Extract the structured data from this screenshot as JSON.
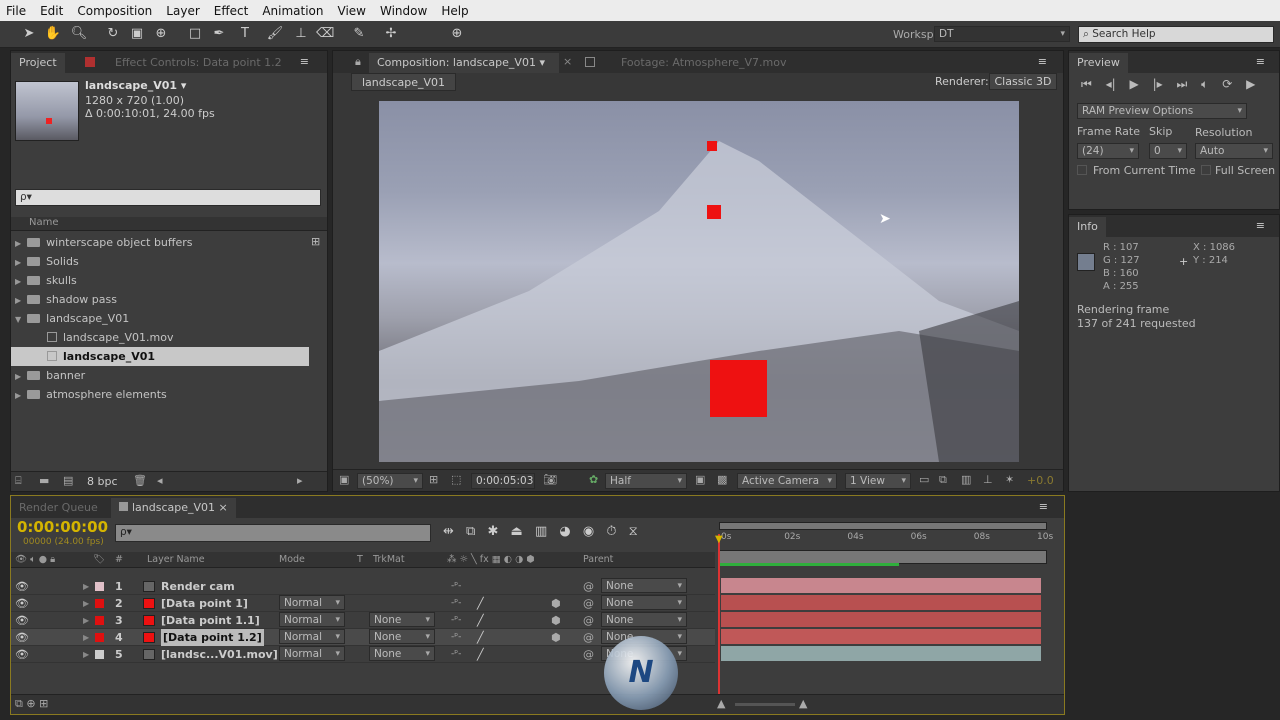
{
  "menu": [
    "File",
    "Edit",
    "Composition",
    "Layer",
    "Effect",
    "Animation",
    "View",
    "Window",
    "Help"
  ],
  "toolbar": {
    "workspace_label": "Workspace:",
    "workspace_value": "DT",
    "search_placeholder": "Search Help"
  },
  "project": {
    "tab": "Project",
    "effect_tab": "Effect Controls: Data point 1.2",
    "comp_name": "landscape_V01 ▾",
    "dims": "1280 x 720 (1.00)",
    "duration": "Δ 0:00:10:01, 24.00 fps",
    "search_placeholder": "ρ▾",
    "column_name": "Name",
    "bpc": "8 bpc",
    "items": [
      {
        "label": "winterscape object buffers",
        "type": "folder",
        "indent": 0
      },
      {
        "label": "Solids",
        "type": "folder",
        "indent": 0
      },
      {
        "label": "skulls",
        "type": "folder",
        "indent": 0
      },
      {
        "label": "shadow pass",
        "type": "folder",
        "indent": 0
      },
      {
        "label": "landscape_V01",
        "type": "folder",
        "indent": 0,
        "open": true
      },
      {
        "label": "landscape_V01.mov",
        "type": "footage",
        "indent": 1
      },
      {
        "label": "landscape_V01",
        "type": "comp",
        "indent": 1,
        "selected": true
      },
      {
        "label": "banner",
        "type": "folder",
        "indent": 0
      },
      {
        "label": "atmosphere elements",
        "type": "folder",
        "indent": 0
      }
    ]
  },
  "composition": {
    "tab": "Composition: landscape_V01",
    "footage_tab": "Footage: Atmosphere_V7.mov",
    "breadcrumb": "landscape_V01",
    "renderer_label": "Renderer:",
    "renderer_value": "Classic 3D",
    "zoom": "(50%)",
    "timecode": "0:00:05:03",
    "resolution": "Half",
    "camera": "Active Camera",
    "views": "1 View",
    "exposure": "+0.0"
  },
  "preview": {
    "tab": "Preview",
    "ram_options": "RAM Preview Options",
    "frame_rate_label": "Frame Rate",
    "skip_label": "Skip",
    "resolution_label": "Resolution",
    "frame_rate": "(24)",
    "skip": "0",
    "resolution": "Auto",
    "from_current": "From Current Time",
    "full_screen": "Full Screen"
  },
  "info": {
    "tab": "Info",
    "r": "R : 107",
    "g": "G : 127",
    "b": "B : 160",
    "a": "A : 255",
    "x": "X : 1086",
    "y": "Y : 214",
    "status_line1": "Rendering frame",
    "status_line2": "137 of 241 requested"
  },
  "timeline": {
    "render_queue_tab": "Render Queue",
    "comp_tab": "landscape_V01",
    "timecode": "0:00:00:00",
    "frames": "00000 (24.00 fps)",
    "search_placeholder": "ρ▾",
    "headers": {
      "num": "#",
      "layer_name": "Layer Name",
      "mode": "Mode",
      "t": "T",
      "trkmat": "TrkMat",
      "parent": "Parent"
    },
    "ruler": [
      "0s",
      "02s",
      "04s",
      "06s",
      "08s",
      "10s"
    ],
    "work_area_rendered_pct": 55,
    "layers": [
      {
        "num": "1",
        "name": "Render cam",
        "mode": "",
        "trkmat": "",
        "parent": "None",
        "color": "#e0c0c8",
        "bar": "#c8868e"
      },
      {
        "num": "2",
        "name": "[Data point 1]",
        "mode": "Normal",
        "trkmat": "",
        "parent": "None",
        "color": "#e01010",
        "bar": "#b85050"
      },
      {
        "num": "3",
        "name": "[Data point 1.1]",
        "mode": "Normal",
        "trkmat": "None",
        "parent": "None",
        "color": "#e01010",
        "bar": "#b85050"
      },
      {
        "num": "4",
        "name": "[Data point 1.2]",
        "mode": "Normal",
        "trkmat": "None",
        "parent": "None",
        "color": "#e01010",
        "bar": "#c05858",
        "selected": true
      },
      {
        "num": "5",
        "name": "[landsc...V01.mov]",
        "mode": "Normal",
        "trkmat": "None",
        "parent": "None",
        "color": "#cccccc",
        "bar": "#8fa6a6"
      }
    ]
  },
  "colors": {
    "accent_timecode": "#d4b400",
    "data_point_red": "#ee1111"
  }
}
